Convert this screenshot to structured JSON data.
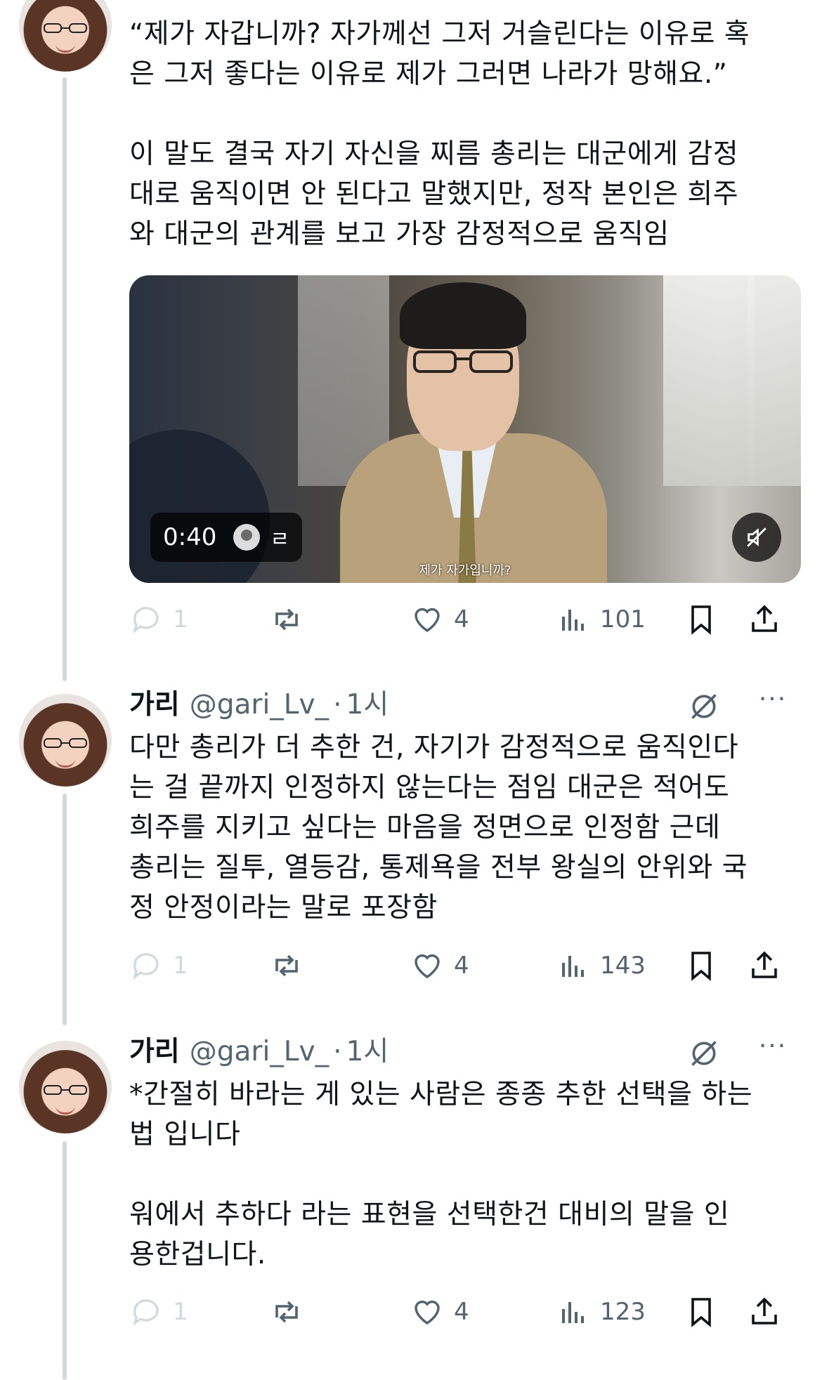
{
  "posts": [
    {
      "text": "“제가 자갑니까? 자가께선 그저 거슬린다는 이유로 혹\n은 그저 좋다는 이유로 제가 그러면 나라가 망해요.”\n\n이 말도 결국 자기 자신을 찌름 총리는 대군에게 감정\n대로 움직이면 안 된다고 말했지만, 정작 본인은 희주\n와 대군의 관계를 보고 가장 감정적으로 움직임",
      "video": {
        "duration": "0:40",
        "channel_glyph": "ㄹ",
        "subtitle": "제가 자가입니까?"
      },
      "stats": {
        "replies": "1",
        "likes": "4",
        "views": "101"
      }
    },
    {
      "author": "가리",
      "handle": "@gari_Lv_",
      "dot": "·",
      "time": "1시",
      "text": "다만 총리가 더 추한 건, 자기가 감정적으로 움직인다\n는 걸 끝까지 인정하지 않는다는 점임 대군은 적어도\n희주를 지키고 싶다는 마음을 정면으로 인정함 근데\n총리는 질투, 열등감, 통제욕을 전부 왕실의 안위와 국\n정 안정이라는 말로 포장함",
      "stats": {
        "replies": "1",
        "likes": "4",
        "views": "143"
      }
    },
    {
      "author": "가리",
      "handle": "@gari_Lv_",
      "dot": "·",
      "time": "1시",
      "text": "*간절히 바라는 게 있는 사람은 종종 추한 선택을 하는\n법 입니다\n\n워에서 추하다 라는 표현을 선택한건 대비의 말을 인\n용한겁니다.",
      "stats": {
        "replies": "1",
        "likes": "4",
        "views": "123"
      }
    }
  ],
  "icons": {
    "reply": "reply-icon",
    "repost": "repost-icon",
    "like": "heart-icon",
    "views": "views-icon",
    "bookmark": "bookmark-icon",
    "share": "share-icon",
    "grok": "grok-icon",
    "more": "more-icon",
    "mute": "mute-icon"
  },
  "colors": {
    "muted": "#536471",
    "thread_line": "#cfd9de",
    "text": "#0f1419"
  }
}
